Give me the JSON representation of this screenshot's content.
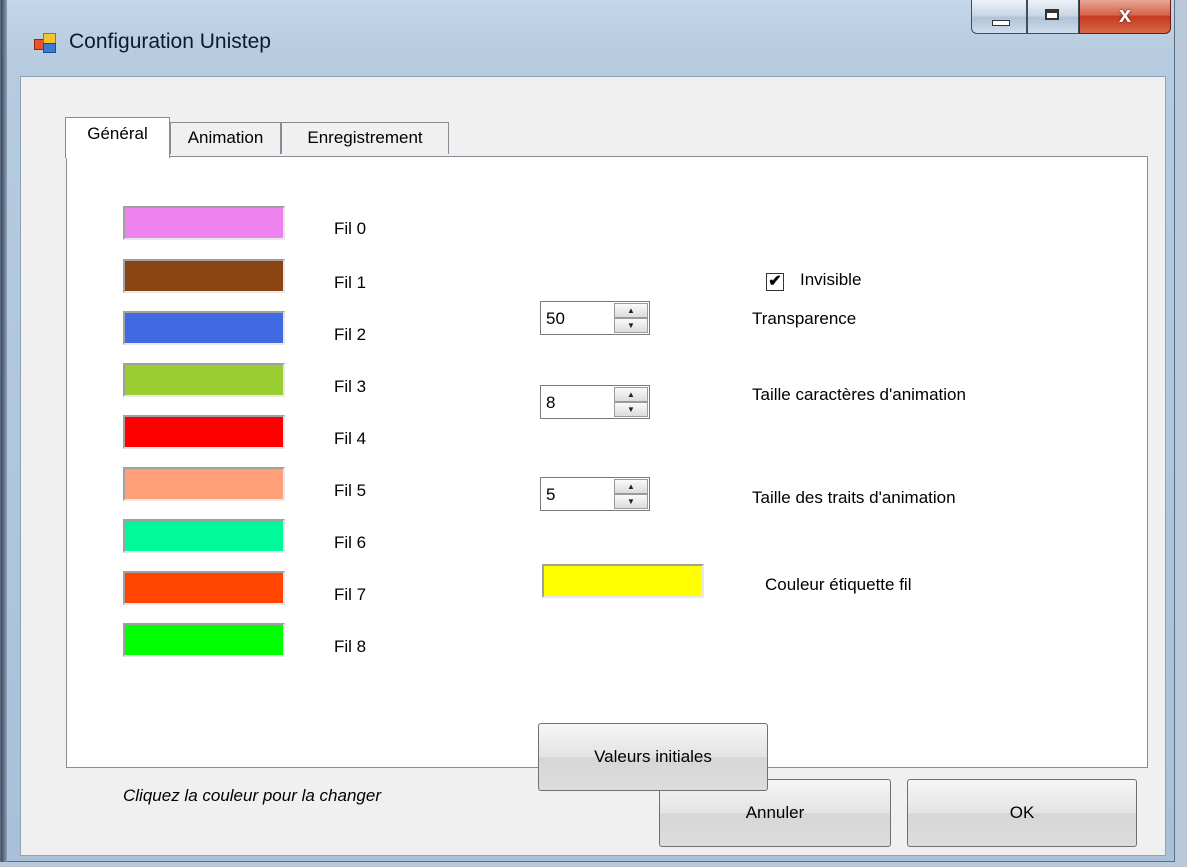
{
  "window": {
    "title": "Configuration Unistep",
    "controls": {
      "minimize_icon": "minimize-icon",
      "maximize_icon": "maximize-icon",
      "close_label": "x"
    }
  },
  "tabs": [
    {
      "label": "Général",
      "active": true
    },
    {
      "label": "Animation",
      "active": false
    },
    {
      "label": "Enregistrement",
      "active": false
    }
  ],
  "colors": [
    {
      "label": "Fil 0",
      "color": "#EE82EE"
    },
    {
      "label": "Fil 1",
      "color": "#8B4513"
    },
    {
      "label": "Fil 2",
      "color": "#4169E1"
    },
    {
      "label": "Fil 3",
      "color": "#9ACD32"
    },
    {
      "label": "Fil 4",
      "color": "#FF0000"
    },
    {
      "label": "Fil 5",
      "color": "#FFA07A"
    },
    {
      "label": "Fil 6",
      "color": "#00FA9A"
    },
    {
      "label": "Fil 7",
      "color": "#FF4500"
    },
    {
      "label": "Fil 8",
      "color": "#00FF00"
    }
  ],
  "hint": "Cliquez la couleur pour la changer",
  "invisible": {
    "label": "Invisible",
    "checked": true,
    "check_glyph": "✔"
  },
  "transparence": {
    "value": "50",
    "label": "Transparence"
  },
  "char_size": {
    "value": "8",
    "label": "Taille caractères d'animation"
  },
  "stroke_size": {
    "value": "5",
    "label": "Taille des traits d'animation"
  },
  "label_color": {
    "color": "#FFFF00",
    "label": "Couleur étiquette fil"
  },
  "buttons": {
    "reset": "Valeurs initiales",
    "cancel": "Annuler",
    "ok": "OK"
  }
}
